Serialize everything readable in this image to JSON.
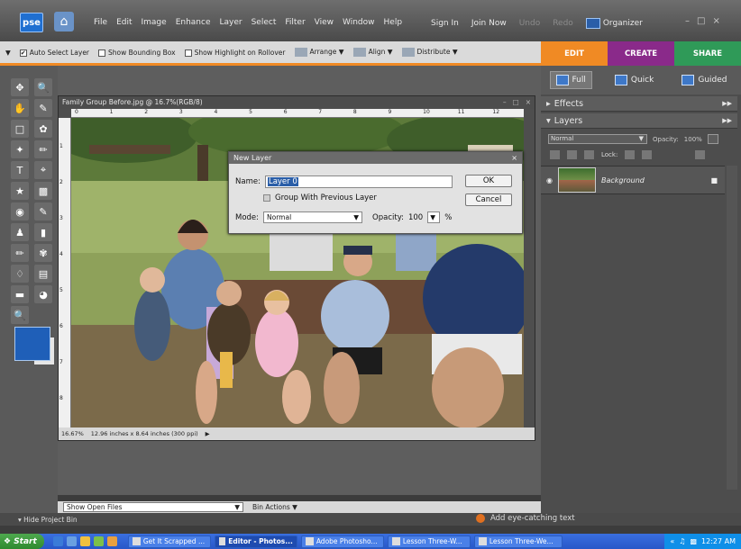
{
  "app": {
    "logo": "pse"
  },
  "menu": [
    "File",
    "Edit",
    "Image",
    "Enhance",
    "Layer",
    "Select",
    "Filter",
    "View",
    "Window",
    "Help"
  ],
  "titlebar_right": {
    "sign_in": "Sign In",
    "join_now": "Join Now",
    "undo": "Undo",
    "redo": "Redo",
    "organizer": "Organizer"
  },
  "options_bar": {
    "auto_select_layer": "Auto Select Layer",
    "show_bounding_box": "Show Bounding Box",
    "show_highlight": "Show Highlight on Rollover",
    "arrange": "Arrange",
    "align": "Align",
    "distribute": "Distribute"
  },
  "tabs": {
    "edit": "EDIT",
    "create": "CREATE",
    "share": "SHARE"
  },
  "modes": {
    "full": "Full",
    "quick": "Quick",
    "guided": "Guided"
  },
  "document": {
    "title": "Family Group Before.jpg @ 16.7%(RGB/8)",
    "zoom": "16.67%",
    "doc_size": "12.96 inches x 8.64 inches (300 ppi)",
    "ruler_h": [
      "0",
      "1",
      "2",
      "3",
      "4",
      "5",
      "6",
      "7",
      "8",
      "9",
      "10",
      "11",
      "12"
    ],
    "ruler_v": [
      "1",
      "2",
      "3",
      "4",
      "5",
      "6",
      "7",
      "8"
    ]
  },
  "dialog": {
    "title": "New Layer",
    "name_label": "Name:",
    "name_value": "Layer 0",
    "group_label": "Group With Previous Layer",
    "mode_label": "Mode:",
    "mode_value": "Normal",
    "opacity_label": "Opacity:",
    "opacity_value": "100",
    "opacity_unit": "%",
    "ok": "OK",
    "cancel": "Cancel"
  },
  "panels": {
    "effects": "Effects",
    "layers": "Layers",
    "blend_mode": "Normal",
    "opacity_label": "Opacity:",
    "opacity_value": "100%",
    "lock_label": "Lock:",
    "layer_name": "Background"
  },
  "bin": {
    "show_open_files": "Show Open Files",
    "bin_actions": "Bin Actions",
    "hide_project_bin": "Hide Project Bin",
    "hint": "Add eye-catching text"
  },
  "taskbar": {
    "start": "Start",
    "tasks": [
      "Get It Scrapped ...",
      "Editor - Photos...",
      "Adobe Photosho...",
      "Lesson Three-W...",
      "Lesson Three-We..."
    ],
    "time": "12:27 AM"
  }
}
